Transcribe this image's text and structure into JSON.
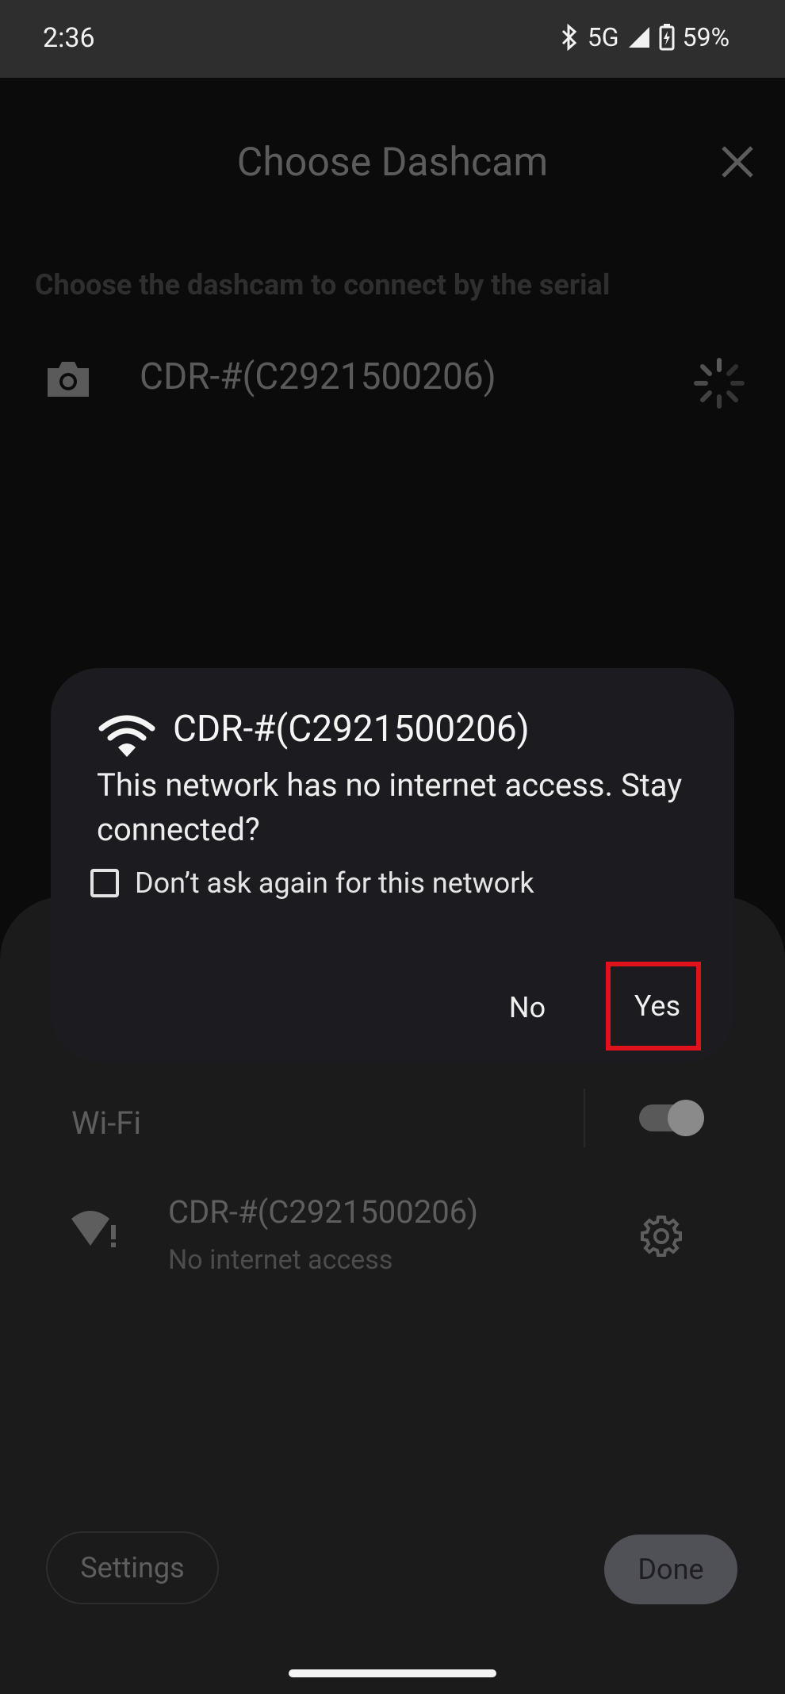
{
  "status_bar": {
    "time": "2:36",
    "network": "5G",
    "battery": "59%"
  },
  "app": {
    "title": "Choose Dashcam",
    "subtitle": "Choose the dashcam to connect by the serial",
    "dashcam_item": "CDR-#(C2921500206)"
  },
  "wifi_panel": {
    "wifi_label": "Wi-Fi",
    "network_name": "CDR-#(C2921500206)",
    "network_status": "No internet access",
    "wifi_enabled": true,
    "settings_button": "Settings",
    "done_button": "Done"
  },
  "dialog": {
    "title": "CDR-#(C2921500206)",
    "message": "This network has no internet access. Stay connected?",
    "checkbox_label": "Don’t ask again for this network",
    "no_button": "No",
    "yes_button": "Yes"
  },
  "colors": {
    "highlight": "#e0121b",
    "dialog_bg": "#1c1b20",
    "sheet_bg": "#1b1b1b"
  }
}
